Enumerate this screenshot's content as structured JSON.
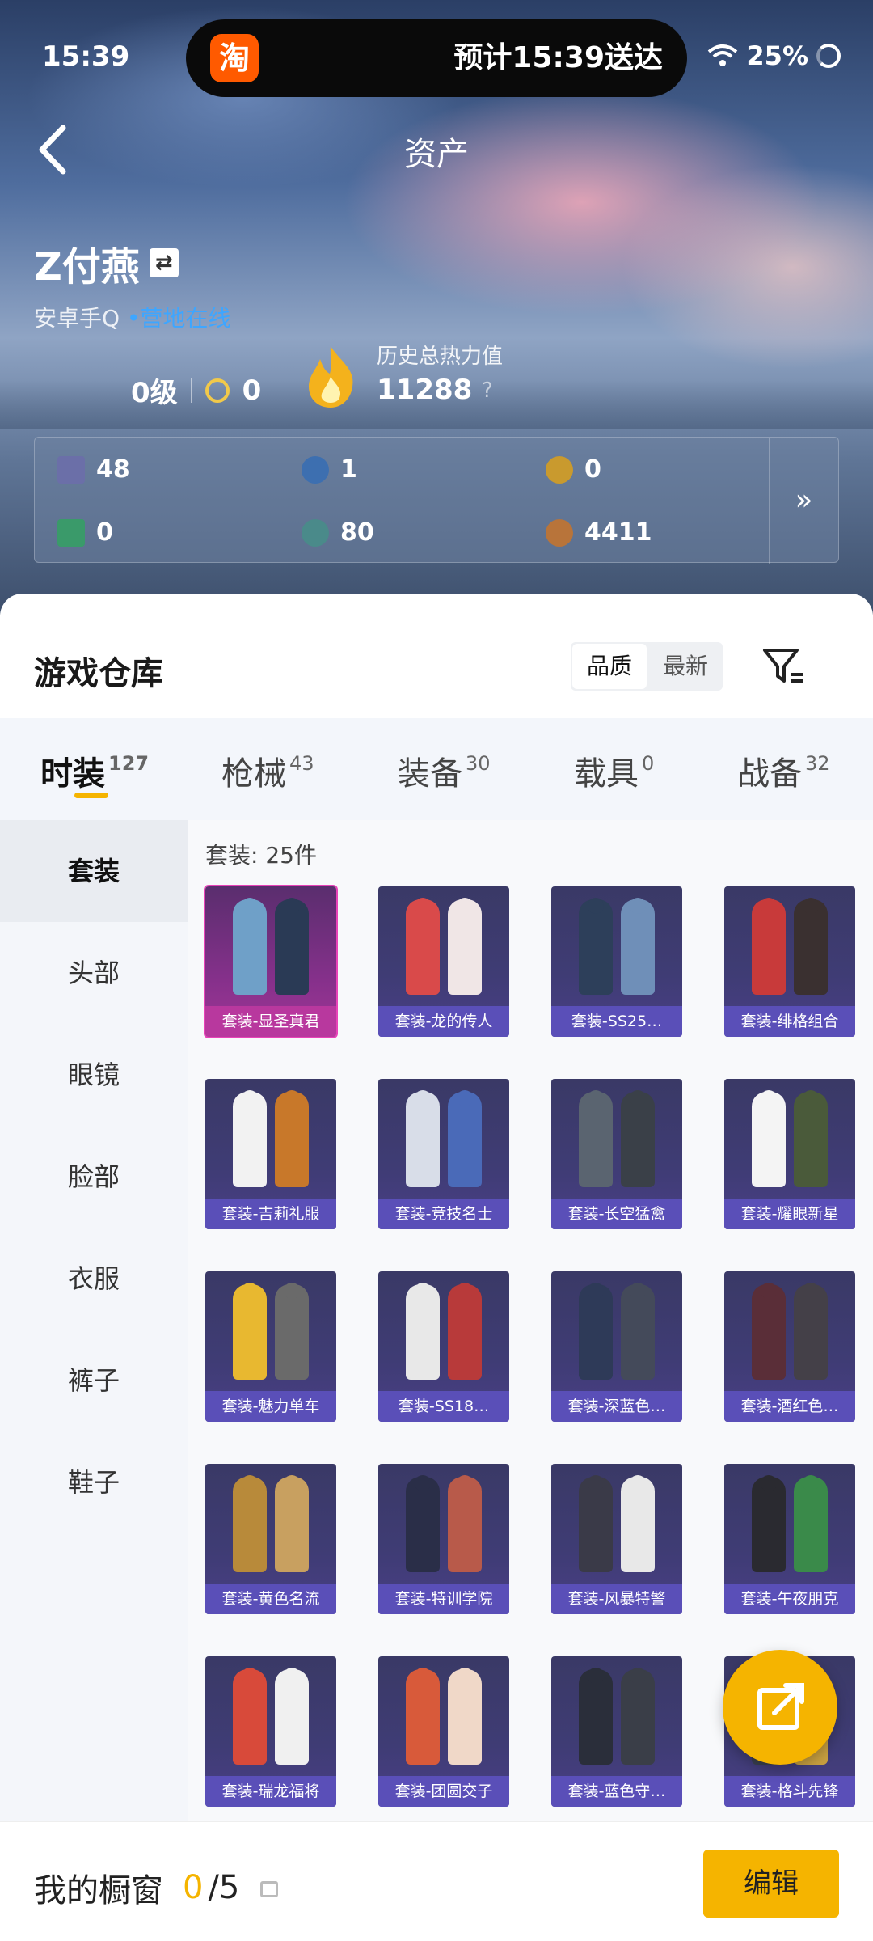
{
  "status": {
    "time": "15:39",
    "delivery": "预计15:39送达",
    "battery": "25%",
    "app_badge": "淘"
  },
  "header": {
    "title": "资产"
  },
  "player": {
    "name": "Z付燕",
    "platform": "安卓手Q",
    "online": "营地在线",
    "level": "0级",
    "coins": "0",
    "heat_label": "历史总热力值",
    "heat_value": "11288",
    "heat_help": "?"
  },
  "stats": [
    {
      "icon": "card-icon",
      "value": "48",
      "color": "#6b6fa8"
    },
    {
      "icon": "token-blue-icon",
      "value": "1",
      "color": "#3d6fb0"
    },
    {
      "icon": "token-gold-icon",
      "value": "0",
      "color": "#c99a2e"
    },
    {
      "icon": "ticket-green-icon",
      "value": "0",
      "color": "#3a9a6a"
    },
    {
      "icon": "orb-teal-icon",
      "value": "80",
      "color": "#4a8a8a"
    },
    {
      "icon": "coin-bronze-icon",
      "value": "4411",
      "color": "#b8743a"
    }
  ],
  "warehouse": {
    "title": "游戏仓库",
    "sort_options": [
      "品质",
      "最新"
    ],
    "sort_selected": "品质"
  },
  "tabs": [
    {
      "label": "时装",
      "count": "127"
    },
    {
      "label": "枪械",
      "count": "43"
    },
    {
      "label": "装备",
      "count": "30"
    },
    {
      "label": "载具",
      "count": "0"
    },
    {
      "label": "战备",
      "count": "32"
    }
  ],
  "sidebar": [
    "套装",
    "头部",
    "眼镜",
    "脸部",
    "衣服",
    "裤子",
    "鞋子"
  ],
  "grid": {
    "count_label": "套装: 25件",
    "items": [
      {
        "label": "套装-显圣真君",
        "c1": "#6fa0c8",
        "c2": "#2a3a55"
      },
      {
        "label": "套装-龙的传人",
        "c1": "#d94a4a",
        "c2": "#f0e6e6"
      },
      {
        "label": "套装-SS25…",
        "c1": "#2d3f5a",
        "c2": "#6f8fb8"
      },
      {
        "label": "套装-绯格组合",
        "c1": "#c83a3a",
        "c2": "#3a3030"
      },
      {
        "label": "套装-吉莉礼服",
        "c1": "#f2f2f2",
        "c2": "#c8782a"
      },
      {
        "label": "套装-竞技名士",
        "c1": "#d8dde8",
        "c2": "#4a6ab8"
      },
      {
        "label": "套装-长空猛禽",
        "c1": "#5a6470",
        "c2": "#3a4048"
      },
      {
        "label": "套装-耀眼新星",
        "c1": "#f4f4f4",
        "c2": "#4a5a3a"
      },
      {
        "label": "套装-魅力单车",
        "c1": "#e8b830",
        "c2": "#6a6a6a"
      },
      {
        "label": "套装-SS18…",
        "c1": "#e8e8e8",
        "c2": "#b83a3a"
      },
      {
        "label": "套装-深蓝色…",
        "c1": "#2e3a58",
        "c2": "#444a5a"
      },
      {
        "label": "套装-酒红色…",
        "c1": "#5a2e38",
        "c2": "#444048"
      },
      {
        "label": "套装-黄色名流",
        "c1": "#b88a3a",
        "c2": "#c8a060"
      },
      {
        "label": "套装-特训学院",
        "c1": "#2a2e48",
        "c2": "#b85a4a"
      },
      {
        "label": "套装-风暴特警",
        "c1": "#3a3a48",
        "c2": "#e8e8e8"
      },
      {
        "label": "套装-午夜朋克",
        "c1": "#2a2a30",
        "c2": "#3a8a4a"
      },
      {
        "label": "套装-瑞龙福将",
        "c1": "#d84a3a",
        "c2": "#f0f0f0"
      },
      {
        "label": "套装-团圆交子",
        "c1": "#d85a3a",
        "c2": "#f0d8c8"
      },
      {
        "label": "套装-蓝色守…",
        "c1": "#2a2e3a",
        "c2": "#3a3e48"
      },
      {
        "label": "套装-格斗先锋",
        "c1": "#3a4050",
        "c2": "#c8a040"
      }
    ]
  },
  "bottom": {
    "title": "我的橱窗",
    "count": "0",
    "total": "/5",
    "edit_label": "编辑"
  }
}
